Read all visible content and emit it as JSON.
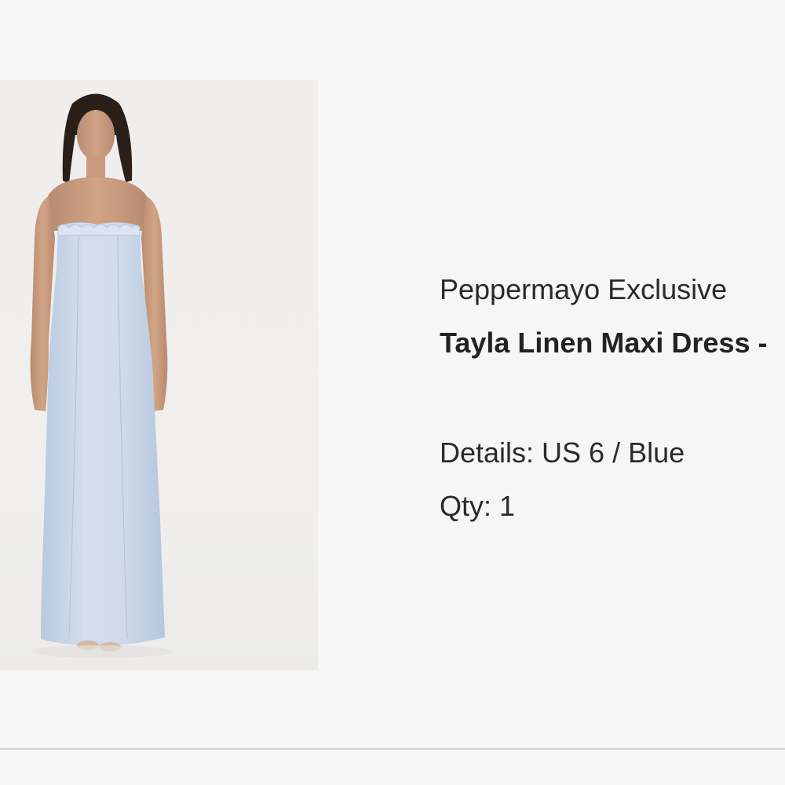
{
  "product": {
    "brand": "Peppermayo Exclusive",
    "name": "Tayla Linen Maxi Dress -",
    "details": "Details: US 6 / Blue",
    "qty": "Qty: 1",
    "image_alt": "Model wearing a light blue strapless linen maxi dress"
  },
  "colors": {
    "dress": "#c9d6e9",
    "background": "#f6f6f6"
  }
}
